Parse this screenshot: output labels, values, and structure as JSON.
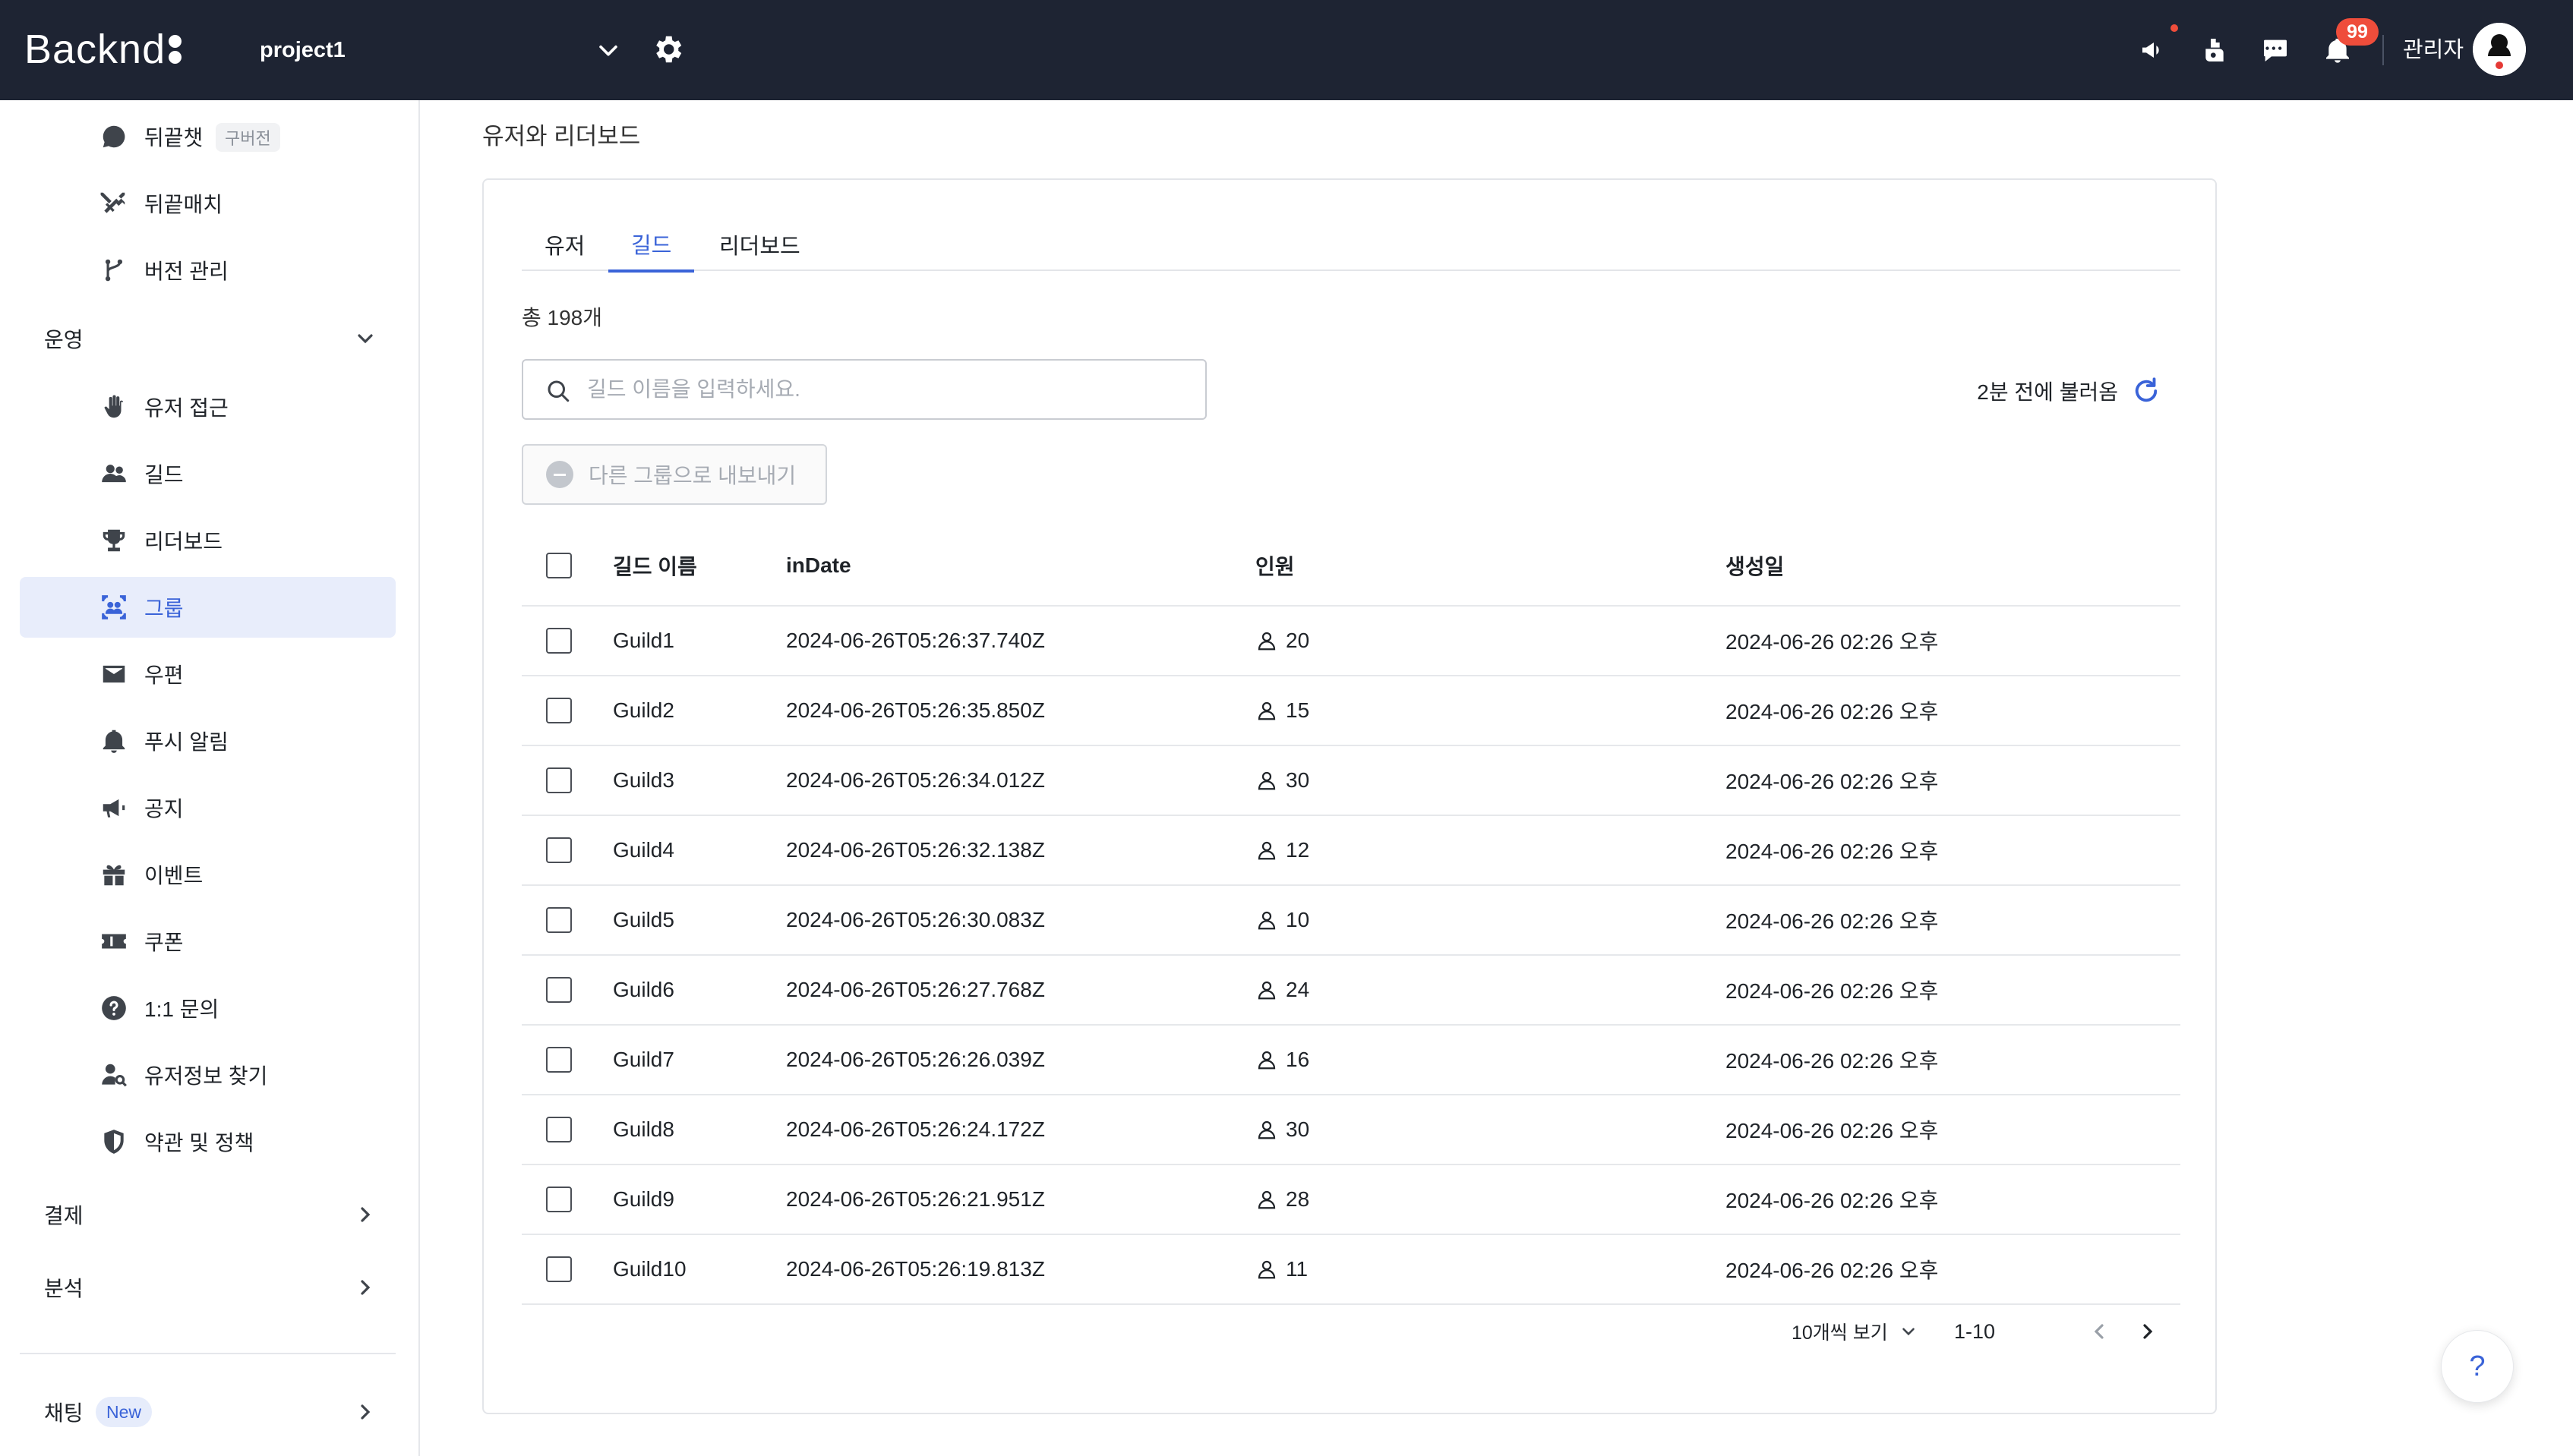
{
  "header": {
    "brand": "Backnd",
    "project_name": "project1",
    "notification_count": "99",
    "admin_label": "관리자"
  },
  "sidebar": {
    "top_items": [
      {
        "label": "뒤끝챗",
        "tag": "구버전",
        "icon": "chat-bubble-icon"
      },
      {
        "label": "뒤끝매치",
        "icon": "crossed-swords-icon"
      },
      {
        "label": "버전 관리",
        "icon": "branch-icon"
      }
    ],
    "section_operation": "운영",
    "operation_items": [
      {
        "label": "유저 접근",
        "icon": "hand-icon"
      },
      {
        "label": "길드",
        "icon": "people-icon"
      },
      {
        "label": "리더보드",
        "icon": "trophy-icon"
      },
      {
        "label": "그룹",
        "icon": "group-focus-icon",
        "active": true
      },
      {
        "label": "우편",
        "icon": "mail-icon"
      },
      {
        "label": "푸시 알림",
        "icon": "bell-icon"
      },
      {
        "label": "공지",
        "icon": "megaphone-icon"
      },
      {
        "label": "이벤트",
        "icon": "gift-icon"
      },
      {
        "label": "쿠폰",
        "icon": "ticket-icon"
      },
      {
        "label": "1:1 문의",
        "icon": "question-icon"
      },
      {
        "label": "유저정보 찾기",
        "icon": "user-search-icon"
      },
      {
        "label": "약관 및 정책",
        "icon": "shield-icon"
      }
    ],
    "section_payment": "결제",
    "section_analytics": "분석",
    "section_chatting": "채팅",
    "chatting_tag": "New"
  },
  "main": {
    "page_title": "유저와 리더보드",
    "tabs": [
      "유저",
      "길드",
      "리더보드"
    ],
    "active_tab": "길드",
    "total_count": "총 198개",
    "search_placeholder": "길드 이름을 입력하세요.",
    "refresh_text": "2분 전에 불러옴",
    "export_label": "다른 그룹으로 내보내기",
    "columns": [
      "길드 이름",
      "inDate",
      "인원",
      "생성일"
    ],
    "rows": [
      {
        "name": "Guild1",
        "inDate": "2024-06-26T05:26:37.740Z",
        "members": "20",
        "created": "2024-06-26 02:26 오후"
      },
      {
        "name": "Guild2",
        "inDate": "2024-06-26T05:26:35.850Z",
        "members": "15",
        "created": "2024-06-26 02:26 오후"
      },
      {
        "name": "Guild3",
        "inDate": "2024-06-26T05:26:34.012Z",
        "members": "30",
        "created": "2024-06-26 02:26 오후"
      },
      {
        "name": "Guild4",
        "inDate": "2024-06-26T05:26:32.138Z",
        "members": "12",
        "created": "2024-06-26 02:26 오후"
      },
      {
        "name": "Guild5",
        "inDate": "2024-06-26T05:26:30.083Z",
        "members": "10",
        "created": "2024-06-26 02:26 오후"
      },
      {
        "name": "Guild6",
        "inDate": "2024-06-26T05:26:27.768Z",
        "members": "24",
        "created": "2024-06-26 02:26 오후"
      },
      {
        "name": "Guild7",
        "inDate": "2024-06-26T05:26:26.039Z",
        "members": "16",
        "created": "2024-06-26 02:26 오후"
      },
      {
        "name": "Guild8",
        "inDate": "2024-06-26T05:26:24.172Z",
        "members": "30",
        "created": "2024-06-26 02:26 오후"
      },
      {
        "name": "Guild9",
        "inDate": "2024-06-26T05:26:21.951Z",
        "members": "28",
        "created": "2024-06-26 02:26 오후"
      },
      {
        "name": "Guild10",
        "inDate": "2024-06-26T05:26:19.813Z",
        "members": "11",
        "created": "2024-06-26 02:26 오후"
      }
    ],
    "pagination": {
      "page_size_label": "10개씩 보기",
      "range": "1-10"
    }
  },
  "help_button_label": "?",
  "colors": {
    "topbar_bg": "#1e2433",
    "accent": "#3a63d8",
    "active_bg": "#e8edfb",
    "badge_red": "#ef4d3b"
  }
}
